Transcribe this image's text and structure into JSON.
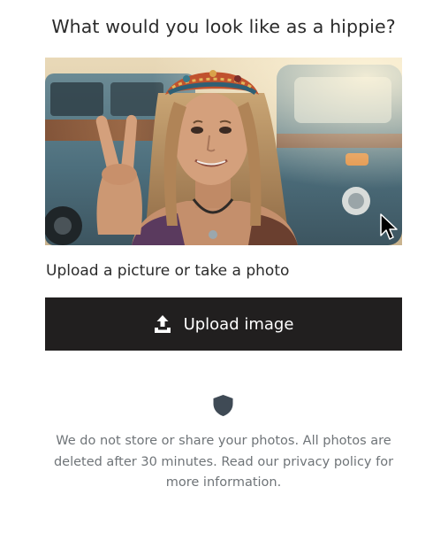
{
  "page": {
    "title": "What would you look like as a hippie?",
    "subtitle": "Upload a picture or take a photo",
    "upload_button_label": "Upload image",
    "privacy_text": "We do not store or share your photos. All photos are deleted after 30 minutes. Read our privacy policy for more information."
  },
  "icons": {
    "upload": "upload-icon",
    "shield": "shield-icon",
    "cursor": "mouse-pointer-icon"
  },
  "colors": {
    "button_bg": "#211f1f",
    "button_text": "#ffffff",
    "title_text": "#2b2b2b",
    "muted_text": "#6f7478",
    "shield": "#3f4a55"
  }
}
